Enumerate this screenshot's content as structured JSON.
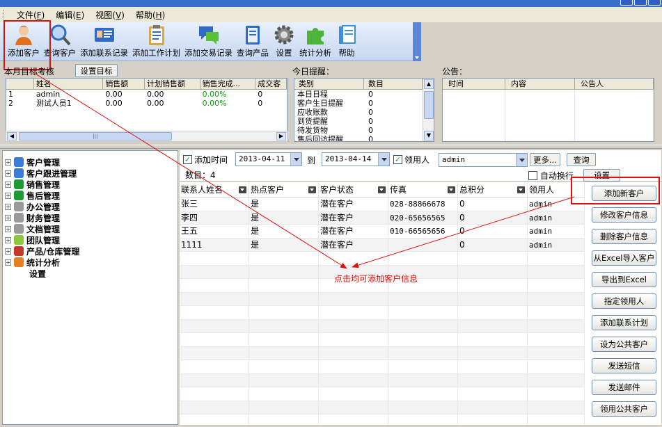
{
  "menu": [
    {
      "label": "文件",
      "key": "F"
    },
    {
      "label": "编辑",
      "key": "E"
    },
    {
      "label": "视图",
      "key": "V"
    },
    {
      "label": "帮助",
      "key": "H"
    }
  ],
  "toolbar": [
    {
      "label": "添加客户",
      "icon": "person-icon"
    },
    {
      "label": "查询客户",
      "icon": "magnifier-icon"
    },
    {
      "label": "添加联系记录",
      "icon": "contact-card-icon"
    },
    {
      "label": "添加工作计划",
      "icon": "clipboard-icon"
    },
    {
      "label": "添加交易记录",
      "icon": "chat-bubbles-icon"
    },
    {
      "label": "查询产品",
      "icon": "book-icon"
    },
    {
      "label": "设置",
      "icon": "gear-icon"
    },
    {
      "label": "统计分析",
      "icon": "puzzle-icon"
    },
    {
      "label": "帮助",
      "icon": "help-book-icon"
    }
  ],
  "target_panel": {
    "title": "本月目标考核",
    "set_target_button": "设置目标",
    "columns": [
      "",
      "姓名",
      "销售额",
      "计划销售额",
      "销售完成...",
      "成交客"
    ],
    "rows": [
      {
        "idx": "1",
        "name": "admin",
        "sales": "0.00",
        "plan": "0.00",
        "pct": "0.00%",
        "deals": "0"
      },
      {
        "idx": "2",
        "name": "测试人员1",
        "sales": "0.00",
        "plan": "0.00",
        "pct": "0.00%",
        "deals": "0"
      }
    ]
  },
  "reminder_panel": {
    "title": "今日提醒：",
    "columns": [
      "类别",
      "数目"
    ],
    "rows": [
      {
        "category": "本日日程",
        "count": "0"
      },
      {
        "category": "客户生日提醒",
        "count": "0"
      },
      {
        "category": "应收账款",
        "count": "0"
      },
      {
        "category": "到货提醒",
        "count": "0"
      },
      {
        "category": "待发货物",
        "count": "0"
      },
      {
        "category": "售后回访提醒",
        "count": "0"
      }
    ]
  },
  "notice_panel": {
    "title": "公告：",
    "columns": [
      "时间",
      "内容",
      "公告人"
    ]
  },
  "tree": [
    {
      "label": "客户管理",
      "icon": "customer-icon",
      "color": "#3a7bd5"
    },
    {
      "label": "客户跟进管理",
      "icon": "followup-icon",
      "color": "#3a7bd5"
    },
    {
      "label": "销售管理",
      "icon": "sales-icon",
      "color": "#1f9a35"
    },
    {
      "label": "售后管理",
      "icon": "aftersales-icon",
      "color": "#1f9a35"
    },
    {
      "label": "办公管理",
      "icon": "office-icon",
      "color": "#999999"
    },
    {
      "label": "财务管理",
      "icon": "finance-icon",
      "color": "#999999"
    },
    {
      "label": "文档管理",
      "icon": "document-icon",
      "color": "#999999"
    },
    {
      "label": "团队管理",
      "icon": "team-icon",
      "color": "#8cc63f"
    },
    {
      "label": "产品/仓库管理",
      "icon": "product-icon",
      "color": "#c0392b"
    },
    {
      "label": "统计分析",
      "icon": "stats-icon",
      "color": "#e67e22"
    }
  ],
  "tree_leaf": "设置",
  "filter": {
    "add_time_label": "添加时间",
    "date_from": "2013-04-11",
    "to_label": "到",
    "date_to": "2013-04-14",
    "owner_label": "领用人",
    "owner_value": "admin",
    "more_button": "更多...",
    "query_button": "查询",
    "count_label": "数目：",
    "count_value": "4",
    "auto_wrap_label": "自动换行",
    "settings_button": "设置"
  },
  "customer_table": {
    "columns": [
      "联系人姓名",
      "热点客户",
      "客户状态",
      "传真",
      "总积分",
      "领用人"
    ],
    "rows": [
      {
        "name": "张三",
        "hot": "是",
        "status": "潜在客户",
        "fax": "028-88866678",
        "points": "0",
        "owner": "admin"
      },
      {
        "name": "李四",
        "hot": "是",
        "status": "潜在客户",
        "fax": "020-65656565",
        "points": "0",
        "owner": "admin"
      },
      {
        "name": "王五",
        "hot": "是",
        "status": "潜在客户",
        "fax": "010-66565656",
        "points": "0",
        "owner": "admin"
      },
      {
        "name": "1111",
        "hot": "是",
        "status": "潜在客户",
        "fax": "",
        "points": "0",
        "owner": "admin"
      }
    ]
  },
  "actions": [
    "添加新客户",
    "修改客户信息",
    "删除客户信息",
    "从Excel导入客户",
    "导出到Excel",
    "指定领用人",
    "添加联系计划",
    "设为公共客户",
    "发送短信",
    "发送邮件",
    "领用公共客户"
  ],
  "annotation": "点击均可添加客户信息",
  "colors": {
    "highlight": "#e01010",
    "green_text": "#0a9a0a"
  }
}
